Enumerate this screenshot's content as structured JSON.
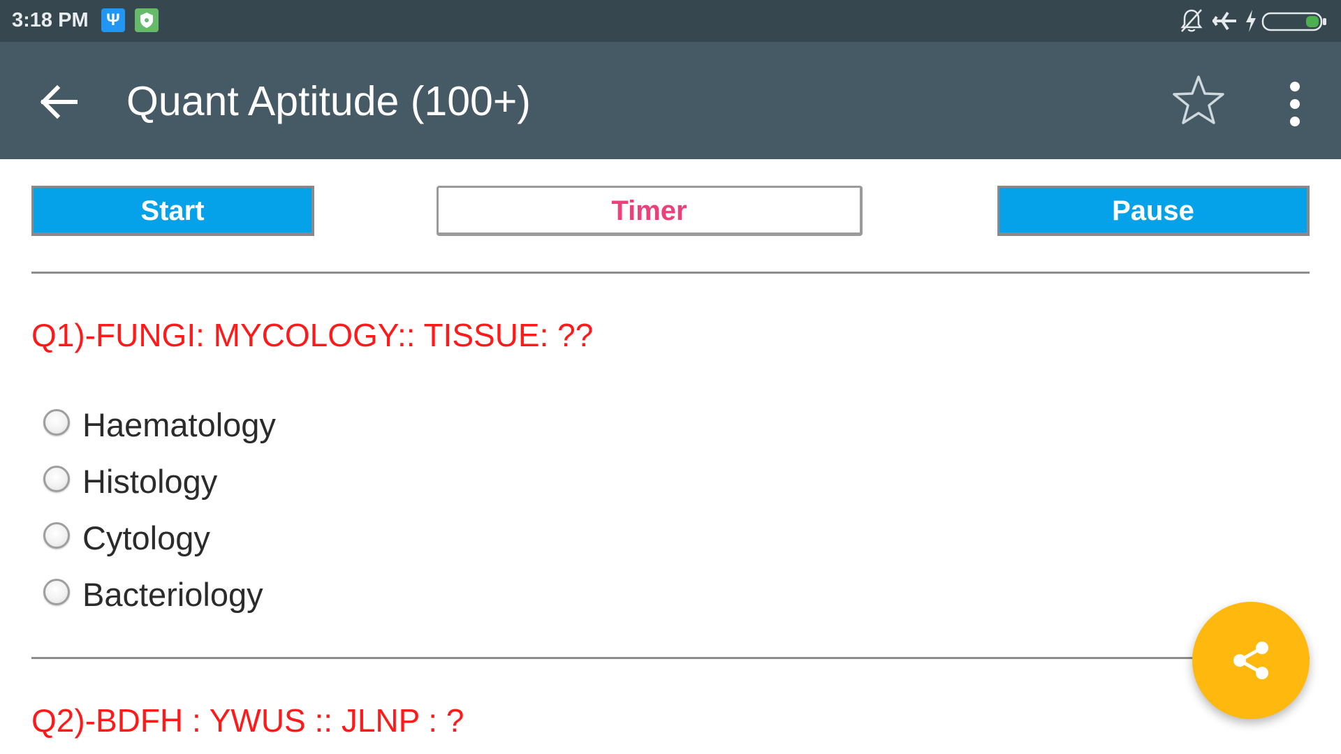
{
  "status_bar": {
    "time": "3:18 PM",
    "left_icons": [
      "usb-icon",
      "shield-icon"
    ],
    "right_icons": [
      "bell-off-icon",
      "airplane-icon",
      "charging-icon",
      "battery-icon"
    ],
    "battery_color": "#4caf50"
  },
  "app_bar": {
    "title": "Quant Aptitude (100+)",
    "background": "#455a64",
    "icons": [
      "back-arrow-icon",
      "star-outline-icon",
      "more-vert-icon"
    ]
  },
  "controls": {
    "start_label": "Start",
    "timer_label": "Timer",
    "pause_label": "Pause",
    "button_color": "#05a2e9",
    "timer_text_color": "#ec407a"
  },
  "questions": [
    {
      "text": "Q1)-FUNGI: MYCOLOGY:: TISSUE: ??",
      "options": [
        "Haematology",
        "Histology",
        "Cytology",
        "Bacteriology"
      ]
    },
    {
      "text": "Q2)-BDFH : YWUS :: JLNP : ?"
    }
  ],
  "fab": {
    "icon": "share-icon",
    "color": "#ffb80d"
  }
}
